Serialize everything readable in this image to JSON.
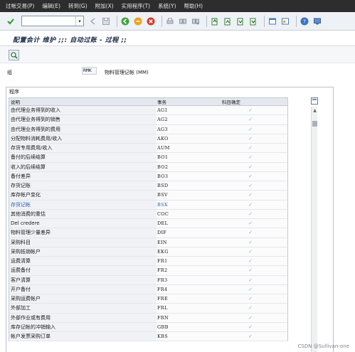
{
  "menubar": {
    "items": [
      "过帐交易(P)",
      "编辑(E)",
      "转到(G)",
      "附加(X)",
      "实用程序(T)",
      "系统(Y)",
      "帮助(H)"
    ]
  },
  "toolbar": {
    "command_value": ""
  },
  "page": {
    "title": "配置会计 维护 ;;: 自动过账 - 过程 ;;"
  },
  "group": {
    "label": "组",
    "value": "RMK",
    "description": "物料管理记帐 (MM)"
  },
  "program": {
    "frame_title": "程序",
    "headers": [
      "说明",
      "事务",
      "科目确定"
    ],
    "rows": [
      {
        "desc": "由代理业务得到的收入",
        "txn": "AG1"
      },
      {
        "desc": "由代理业务得到的销售",
        "txn": "AG2"
      },
      {
        "desc": "由代理业务得到的费用",
        "txn": "AG3"
      },
      {
        "desc": "分配物料消耗费用/收入",
        "txn": "AKO"
      },
      {
        "desc": "存货专用费用/收入",
        "txn": "AUM"
      },
      {
        "desc": "备付的后续结算",
        "txn": "BO1"
      },
      {
        "desc": "收入的后续结算",
        "txn": "BO2"
      },
      {
        "desc": "备付差异",
        "txn": "BO3"
      },
      {
        "desc": "存货记账",
        "txn": "BSD"
      },
      {
        "desc": "库存帐户变化",
        "txn": "BSV"
      },
      {
        "desc": "存货记帐",
        "txn": "BSX"
      },
      {
        "desc": "其他消费的重估",
        "txn": "COC"
      },
      {
        "desc": "Del credere",
        "txn": "DEL"
      },
      {
        "desc": "物料管理少量差异",
        "txn": "DIF"
      },
      {
        "desc": "采购科目",
        "txn": "EIN"
      },
      {
        "desc": "采购抵销帐户",
        "txn": "EKG"
      },
      {
        "desc": "运费清算",
        "txn": "FR1"
      },
      {
        "desc": "运费备付",
        "txn": "FR2"
      },
      {
        "desc": "客户清算",
        "txn": "FR3"
      },
      {
        "desc": "开户备付",
        "txn": "FR4"
      },
      {
        "desc": "采购运费帐户",
        "txn": "FRE"
      },
      {
        "desc": "外部加工",
        "txn": "FRL"
      },
      {
        "desc": "外部作业或有费用",
        "txn": "FRN"
      },
      {
        "desc": "库存记帐的冲销输入",
        "txn": "GBB"
      },
      {
        "desc": "帐户发票采购订单",
        "txn": "KBS"
      }
    ]
  },
  "watermark": "CSDN @Sullivan-one",
  "colors": {
    "menubar_bg": "#2d2d2d",
    "link_text": "#2b62b0",
    "check_gray": "#a0a7b1"
  }
}
